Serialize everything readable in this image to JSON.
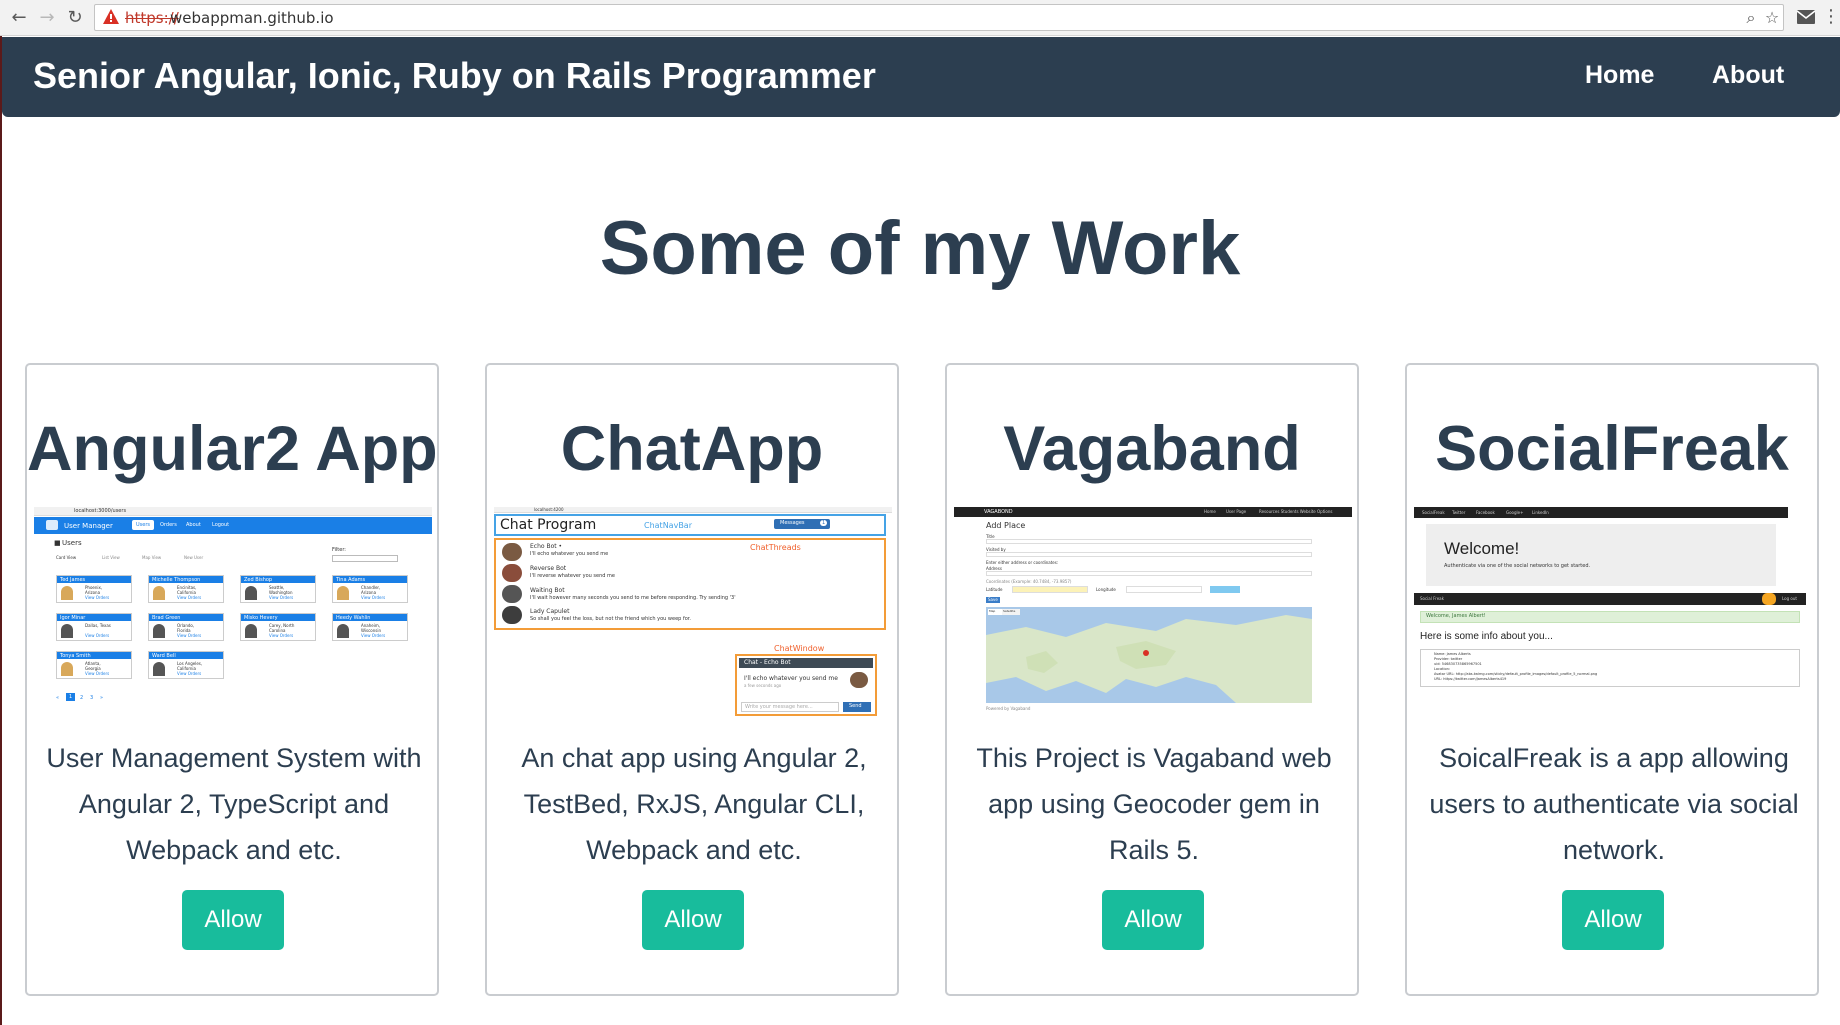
{
  "browser": {
    "url_scheme": "https://",
    "url_host": "webappman.github.io",
    "icons": [
      "back-icon",
      "forward-icon",
      "reload-icon",
      "warning-icon",
      "zoom-icon",
      "star-icon",
      "mail-icon",
      "menu-icon"
    ]
  },
  "navbar": {
    "brand": "Senior Angular, Ionic, Ruby on Rails Programmer",
    "links": [
      "Home",
      "About"
    ]
  },
  "section_title": "Some of my Work",
  "projects": [
    {
      "title": "Angular2 App",
      "description": "User Management System with Angular 2, TypeScript and Webpack and etc.",
      "button": "Allow",
      "shot": {
        "url": "localhost:3000/users",
        "app_title": "User Manager",
        "nav": [
          "Users",
          "Orders",
          "About",
          "Logout"
        ],
        "heading": "Users",
        "views": [
          "Card View",
          "List View",
          "Map View",
          "New User"
        ],
        "filter_label": "Filter:",
        "users": [
          {
            "name": "Ted James",
            "city": "Phoenix,",
            "state": "Arizona"
          },
          {
            "name": "Michelle Thompson",
            "city": "Encinitas,",
            "state": "California"
          },
          {
            "name": "Zed Bishop",
            "city": "Seattle,",
            "state": "Washington"
          },
          {
            "name": "Tina Adams",
            "city": "Chandler,",
            "state": "Arizona"
          },
          {
            "name": "Igor Minar",
            "city": "Dallas, Texas",
            "state": ""
          },
          {
            "name": "Brad Green",
            "city": "Orlando,",
            "state": "Florida"
          },
          {
            "name": "Misko Hevery",
            "city": "Carey, North",
            "state": "Carolina"
          },
          {
            "name": "Heedy Wahlin",
            "city": "Anaheim,",
            "state": "Wisconsin"
          },
          {
            "name": "Tonya Smith",
            "city": "Atlanta,",
            "state": "Georgia"
          },
          {
            "name": "Ward Bell",
            "city": "Los Angeles,",
            "state": "California"
          }
        ],
        "view_orders": "View Orders",
        "pages": [
          "«",
          "1",
          "2",
          "3",
          "»"
        ]
      }
    },
    {
      "title": "ChatApp",
      "description": "An chat app using Angular 2, TestBed, RxJS, Angular CLI, Webpack and etc.",
      "button": "Allow",
      "shot": {
        "url": "localhost:4200",
        "program": "Chat Program",
        "navbar_tag": "ChatNavBar",
        "messages": "Messages",
        "badge": "1",
        "threads_tag": "ChatThreads",
        "threads": [
          {
            "name": "Echo Bot •",
            "msg": "I'll echo whatever you send me"
          },
          {
            "name": "Reverse Bot",
            "msg": "I'll reverse whatever you send me"
          },
          {
            "name": "Waiting Bot",
            "msg": "I'll wait however many seconds you send to me before responding. Try sending '3'"
          },
          {
            "name": "Lady Capulet",
            "msg": "So shall you feel the loss, but not the friend which you weep for."
          }
        ],
        "window_tag": "ChatWindow",
        "window_title": "Chat - Echo Bot",
        "window_msg": "I'll echo whatever you send me",
        "window_time": "a few seconds ago",
        "input_placeholder": "Write your message here...",
        "send": "Send"
      }
    },
    {
      "title": "Vagaband",
      "description": "This Project is Vagaband web app using Geocoder gem in Rails 5.",
      "button": "Allow",
      "shot": {
        "brand": "VAGABOND",
        "nav": [
          "Home",
          "User Page",
          "Resources Students Website Options"
        ],
        "heading": "Add Place",
        "labels": [
          "Title",
          "Visited by",
          "Enter either address or coordinates:",
          "Address"
        ],
        "coords_label": "Coordinates (Example: 40.7484, -73.9857)",
        "latitude": "Latitude",
        "longitude": "Longitude",
        "submit": "Save",
        "map_tabs": [
          "Map",
          "Satellite"
        ],
        "map_footer": "Powered by Vagaband"
      }
    },
    {
      "title": "SocialFreak",
      "description": "SoicalFreak is a app allowing users to authenticate via social network.",
      "button": "Allow",
      "shot": {
        "nav": [
          "SocialFreak",
          "Twitter",
          "Facebook",
          "Google+",
          "LinkedIn"
        ],
        "welcome": "Welcome!",
        "welcome_sub": "Authenticate via one of the social networks to get started.",
        "bar_brand": "Social Freak",
        "logout": "Log out",
        "alert": "Welcome, James Albert!",
        "info_heading": "Here is some info about you...",
        "info": [
          "Name: James Alberts",
          "Provider: twitter",
          "uid: 546830735865967501",
          "Location:",
          "Avatar URL: http://abs.twimg.com/sticky/default_profile_images/default_profile_5_normal.png",
          "URL: https://twitter.com/JamesAlberts419"
        ]
      }
    }
  ],
  "colors": {
    "navbar": "#2c3e50",
    "text": "#2c3e50",
    "button": "#18bc9c",
    "card_border": "#c9ccd0"
  }
}
